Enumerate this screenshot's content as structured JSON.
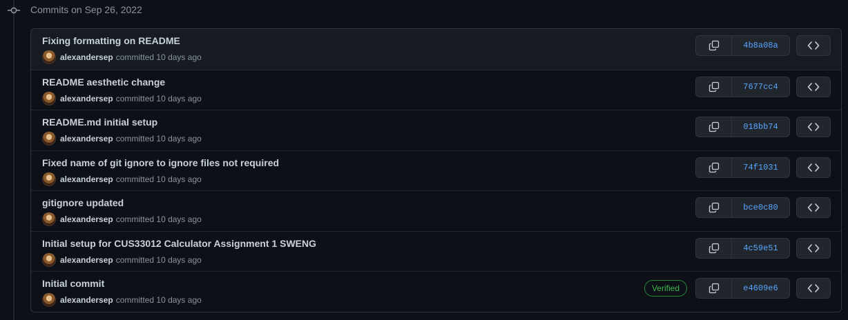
{
  "header": {
    "date_label": "Commits on Sep 26, 2022"
  },
  "commits": [
    {
      "title": "Fixing formatting on README",
      "author": "alexandersep",
      "meta": "committed 10 days ago",
      "sha": "4b8a08a"
    },
    {
      "title": "README aesthetic change",
      "author": "alexandersep",
      "meta": "committed 10 days ago",
      "sha": "7677cc4"
    },
    {
      "title": "README.md initial setup",
      "author": "alexandersep",
      "meta": "committed 10 days ago",
      "sha": "018bb74"
    },
    {
      "title": "Fixed name of git ignore to ignore files not required",
      "author": "alexandersep",
      "meta": "committed 10 days ago",
      "sha": "74f1031"
    },
    {
      "title": "gitignore updated",
      "author": "alexandersep",
      "meta": "committed 10 days ago",
      "sha": "bce0c80"
    },
    {
      "title": "Initial setup for CUS33012 Calculator Assignment 1 SWENG",
      "author": "alexandersep",
      "meta": "committed 10 days ago",
      "sha": "4c59e51"
    },
    {
      "title": "Initial commit",
      "author": "alexandersep",
      "meta": "committed 10 days ago",
      "sha": "e4609e6",
      "badge": "Verified"
    }
  ],
  "icons": {
    "timeline": "git-commit-icon",
    "copy": "copy-icon",
    "browse": "code-icon",
    "avatar": "avatar"
  },
  "colors": {
    "background": "#0d1117",
    "border": "#30363d",
    "link": "#58a6ff",
    "verified": "#3fb950",
    "muted": "#8b949e"
  }
}
